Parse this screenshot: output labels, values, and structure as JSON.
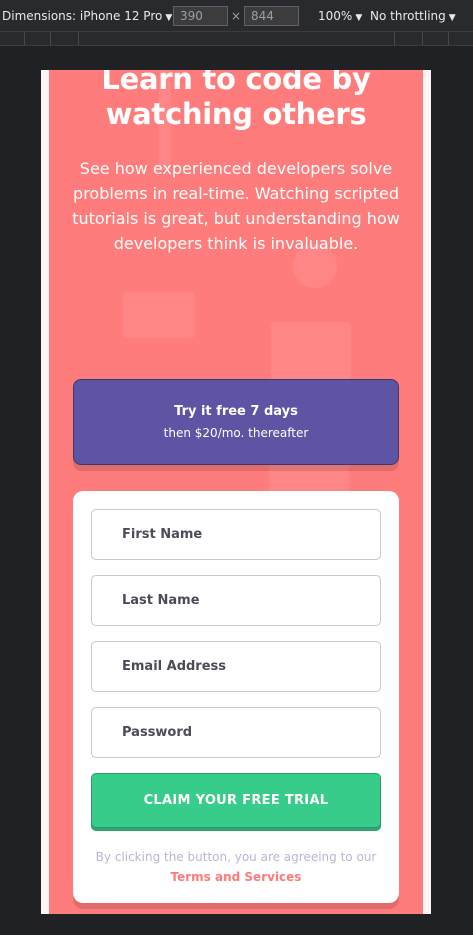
{
  "devtools": {
    "dimensions_label": "Dimensions: iPhone 12 Pro",
    "width_value": "390",
    "height_value": "844",
    "times_symbol": "×",
    "zoom": "100%",
    "throttling": "No throttling"
  },
  "hero": {
    "title": "Learn to code by watching others",
    "description": "See how experienced developers solve problems in real-time. Watching scripted tutorials is great, but understanding how developers think is invaluable."
  },
  "offer": {
    "headline": "Try it free 7 days",
    "price_text": "then $20/mo. thereafter"
  },
  "form": {
    "first_name_placeholder": "First Name",
    "last_name_placeholder": "Last Name",
    "email_placeholder": "Email Address",
    "password_placeholder": "Password",
    "submit_label": "CLAIM YOUR FREE TRIAL",
    "terms_prefix": "By clicking the button, you are agreeing to our",
    "terms_link": "Terms and Services"
  },
  "colors": {
    "background": "#ff7c7c",
    "offer": "#5e54a4",
    "cta": "#38cc8b",
    "link": "#ff7a7a"
  }
}
